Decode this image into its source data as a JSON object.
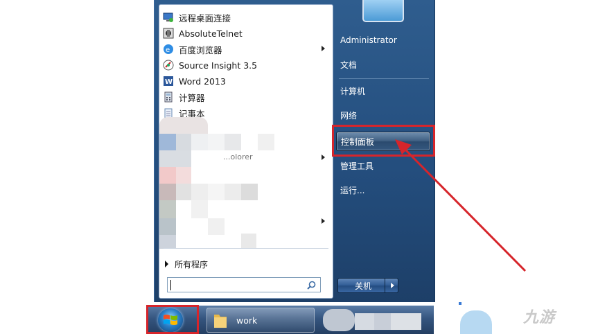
{
  "programs": [
    {
      "label": "远程桌面连接",
      "icon": "remote-desktop-icon"
    },
    {
      "label": "AbsoluteTelnet",
      "icon": "absolutetelnet-icon"
    },
    {
      "label": "百度浏览器",
      "icon": "baidu-browser-icon",
      "has_submenu": true
    },
    {
      "label": "Source Insight 3.5",
      "icon": "source-insight-icon"
    },
    {
      "label": "Word 2013",
      "icon": "word-icon"
    },
    {
      "label": "计算器",
      "icon": "calculator-icon"
    },
    {
      "label": "记事本",
      "icon": "notepad-icon"
    }
  ],
  "blurred_item_fragment": "...olorer",
  "all_programs": "所有程序",
  "search": {
    "value": "",
    "placeholder": ""
  },
  "right_pane": {
    "user": "Administrator",
    "documents": "文档",
    "computer": "计算机",
    "network": "网络",
    "control_panel": "控制面板",
    "admin_tools": "管理工具",
    "run": "运行..."
  },
  "shutdown_label": "关机",
  "taskbar": {
    "work": "work"
  },
  "watermark": "九游",
  "colors": {
    "highlight": "#d6252b",
    "menu_blue": "#244e7e"
  }
}
